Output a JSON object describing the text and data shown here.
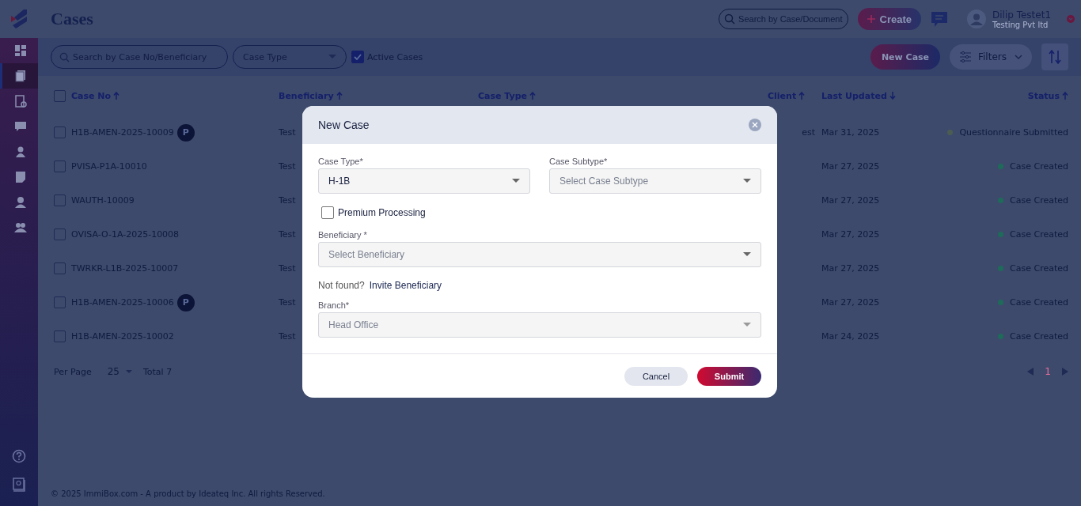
{
  "header": {
    "title": "Cases",
    "search_placeholder": "Search by Case/Document",
    "create_button": "Create",
    "user": {
      "name": "Dilip Testet1",
      "company": "Testing Pvt ltd"
    }
  },
  "sidebar": {
    "items": [
      {
        "selected": false
      },
      {
        "selected": true
      },
      {
        "selected": false
      },
      {
        "selected": false
      },
      {
        "selected": false
      },
      {
        "selected": false
      },
      {
        "selected": false
      },
      {
        "selected": false
      }
    ]
  },
  "toolbar": {
    "search_placeholder": "Search by Case No/Beneficiary",
    "case_type_placeholder": "Case Type",
    "active_cases": {
      "label": "Active Cases",
      "checked": true
    },
    "new_case_button": "New Case",
    "filters_button": "Filters"
  },
  "table": {
    "select_all_checked": false,
    "columns": [
      {
        "label": "Case No",
        "sort_ascending": true
      },
      {
        "label": "Beneficiary",
        "sort_ascending": true
      },
      {
        "label": "Case Type",
        "sort_ascending": true
      },
      {
        "label": "Client",
        "sort_ascending": true
      },
      {
        "label": "Last Updated",
        "sort_ascending": false
      },
      {
        "label": "Status",
        "sort_ascending": true
      }
    ],
    "rows": [
      {
        "checked": false,
        "case_no": "H1B-AMEN-2025-10009",
        "premium": true,
        "premium_badge": "P",
        "beneficiary": "Test",
        "client": "est",
        "last_updated": "Mar 31, 2025",
        "status": "Questionnaire Submitted",
        "color": "#4b5d52"
      },
      {
        "checked": false,
        "case_no": "PVISA-P1A-10010",
        "premium": false,
        "beneficiary": "Test",
        "last_updated": "Mar 27, 2025",
        "status": "Case Created",
        "color": "#1e6b5a"
      },
      {
        "checked": false,
        "case_no": "WAUTH-10009",
        "premium": false,
        "beneficiary": "Test",
        "last_updated": "Mar 27, 2025",
        "status": "Case Created",
        "color": "#1e6b5a"
      },
      {
        "checked": false,
        "case_no": "OVISA-O-1A-2025-10008",
        "premium": false,
        "beneficiary": "Test",
        "last_updated": "Mar 27, 2025",
        "status": "Case Created",
        "color": "#1e6b5a"
      },
      {
        "checked": false,
        "case_no": "TWRKR-L1B-2025-10007",
        "premium": false,
        "beneficiary": "Test",
        "last_updated": "Mar 27, 2025",
        "status": "Case Created",
        "color": "#1e6b5a"
      },
      {
        "checked": false,
        "case_no": "H1B-AMEN-2025-10006",
        "premium": true,
        "premium_badge": "P",
        "beneficiary": "Test",
        "last_updated": "Mar 27, 2025",
        "status": "Case Created",
        "color": "#1e6b5a"
      },
      {
        "checked": false,
        "case_no": "H1B-AMEN-2025-10002",
        "premium": false,
        "beneficiary": "Test",
        "last_updated": "Mar 24, 2025",
        "status": "Case Created",
        "color": "#1e6b5a"
      }
    ]
  },
  "pagination": {
    "per_page_label": "Per Page",
    "per_page_value": "25",
    "total": "Total 7",
    "page": "1"
  },
  "footer": "© 2025 ImmiBox.com - A product by Ideateq Inc. All rights Reserved.",
  "modal": {
    "title": "New Case",
    "case_type": {
      "label": "Case Type*",
      "value": "H-1B"
    },
    "case_subtype": {
      "label": "Case Subtype*",
      "placeholder": "Select Case Subtype"
    },
    "premium_processing": {
      "label": "Premium Processing",
      "checked": false
    },
    "beneficiary": {
      "label": "Beneficiary *",
      "placeholder": "Select Beneficiary"
    },
    "not_found": "Not found?",
    "invite_link": "Invite Beneficiary",
    "branch": {
      "label": "Branch*",
      "value": "Head Office",
      "disabled": true
    },
    "cancel_button": "Cancel",
    "submit_button": "Submit"
  }
}
